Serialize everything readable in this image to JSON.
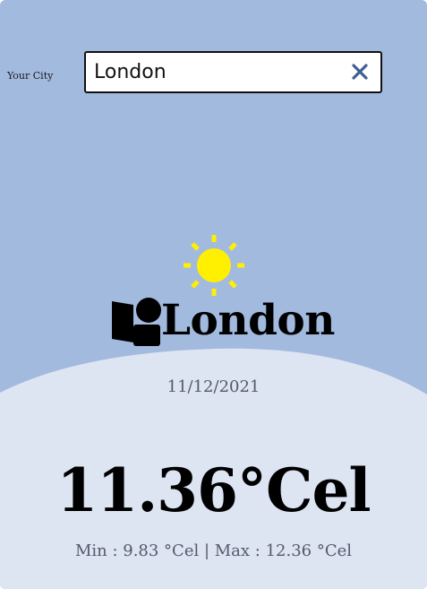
{
  "search": {
    "label": "Your City",
    "value": "London",
    "clear_icon": "close-icon"
  },
  "weather": {
    "icon": "sun-icon",
    "city_icon": "location-person-icon",
    "city": "London",
    "date": "11/12/2021",
    "temperature": "11.36°Cel",
    "min_max": "Min : 9.83 °Cel | Max : 12.36 °Cel"
  },
  "colors": {
    "sky": "#a3badf",
    "ground": "#dde4f2",
    "sun": "#ffef00",
    "clear_icon": "#3f5f95"
  }
}
